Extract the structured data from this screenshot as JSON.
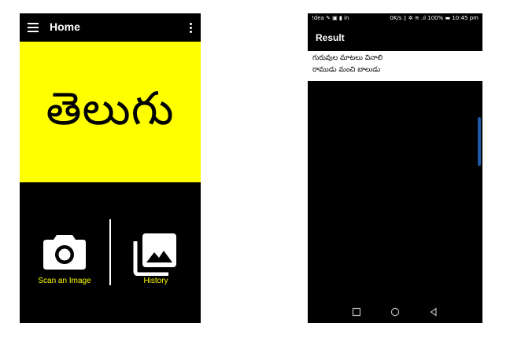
{
  "left_screen": {
    "appbar": {
      "title": "Home"
    },
    "banner": {
      "text": "తెలుగు",
      "background": "#ffff00"
    },
    "actions": {
      "scan_label": "Scan an Image",
      "history_label": "History"
    },
    "icons": [
      "menu-icon",
      "more-vert-icon",
      "camera-icon",
      "photo-library-icon"
    ],
    "accent_color": "#ffff00"
  },
  "right_screen": {
    "status_bar": {
      "left": "!dea ✎ ▣ ▮ in",
      "right": "0K/s ▯ ✲ ≋ .ıl 100% ▬ 10:45 pm"
    },
    "title": "Result",
    "result_lines": [
      "గురువుల మాటలు వినాలి",
      "రాముడు మంచి బాలుడు"
    ],
    "nav_icons": [
      "recent-apps-icon",
      "home-icon",
      "back-icon"
    ]
  }
}
